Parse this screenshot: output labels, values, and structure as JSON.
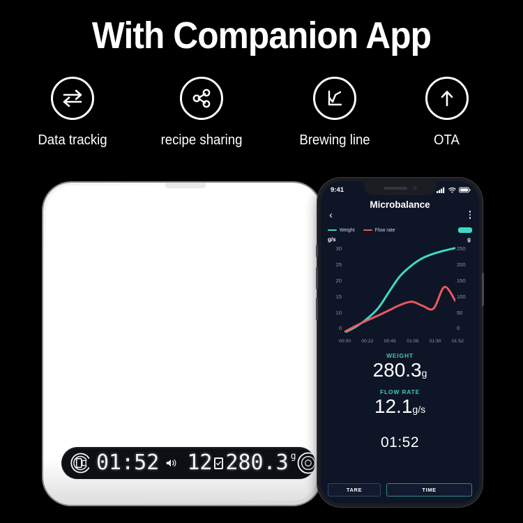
{
  "headline": "With Companion App",
  "features": [
    {
      "icon": "data-sync-icon",
      "label": "Data trackig"
    },
    {
      "icon": "share-nodes-icon",
      "label": "recipe sharing"
    },
    {
      "icon": "line-chart-icon",
      "label": "Brewing line"
    },
    {
      "icon": "upload-arrow-icon",
      "label": "OTA"
    }
  ],
  "scale": {
    "display": {
      "brand_logo": "cd-brand-logo",
      "timer": "01:52",
      "speaker_icon": "speaker-icon",
      "flow_rate": "12",
      "decimal_box_icon": "checkbox-dot-icon",
      "weight": "280.3",
      "unit": "g",
      "right_badge": "circle-badge-logo"
    }
  },
  "phone": {
    "status_bar": {
      "time": "9:41",
      "signal_icon": "cellular-signal-icon",
      "wifi_icon": "wifi-icon",
      "battery_icon": "battery-icon"
    },
    "app": {
      "title": "Microbalance",
      "back_icon": "back-chevron-icon",
      "menu_icon": "kebab-menu-icon",
      "legend": [
        {
          "name": "Weight",
          "color": "#3fd8c4"
        },
        {
          "name": "Flow rate",
          "color": "#e8595f"
        }
      ],
      "recording_pill": "recording-indicator",
      "readouts": [
        {
          "label": "WEIGHT",
          "value": "280.3",
          "unit": "g"
        },
        {
          "label": "FLOW RATE",
          "value": "12.1",
          "unit": "g/s"
        }
      ],
      "timer": "01:52",
      "buttons": [
        {
          "label": "TARE"
        },
        {
          "label": "TIME"
        }
      ]
    }
  },
  "chart_data": {
    "type": "line",
    "title": "",
    "xlabel": "",
    "ylabel": "g/s",
    "ylabel_right": "g",
    "grid": false,
    "legend_position": "top",
    "x_ticks": [
      "00:00",
      "00:22",
      "00:45",
      "01:08",
      "01:30",
      "01:52"
    ],
    "y_ticks_left": [
      0,
      10,
      15,
      20,
      25,
      30
    ],
    "y_ticks_right": [
      0,
      50,
      100,
      150,
      200,
      250
    ],
    "ylim_left": [
      0,
      34
    ],
    "ylim_right": [
      0,
      285
    ],
    "x": [
      0,
      11,
      22,
      34,
      45,
      56,
      68,
      79,
      90,
      101,
      112
    ],
    "series": [
      {
        "name": "Weight",
        "color": "#3fd8c4",
        "axis": "right",
        "unit": "g",
        "values": [
          0,
          18,
          42,
          78,
          130,
          180,
          215,
          238,
          252,
          262,
          270
        ]
      },
      {
        "name": "Flow rate",
        "color": "#e8595f",
        "axis": "left",
        "unit": "g/s",
        "values": [
          0.3,
          2.5,
          4.5,
          6.5,
          8.5,
          10.5,
          11.8,
          10.2,
          9.2,
          17.4,
          12.1
        ]
      }
    ]
  }
}
